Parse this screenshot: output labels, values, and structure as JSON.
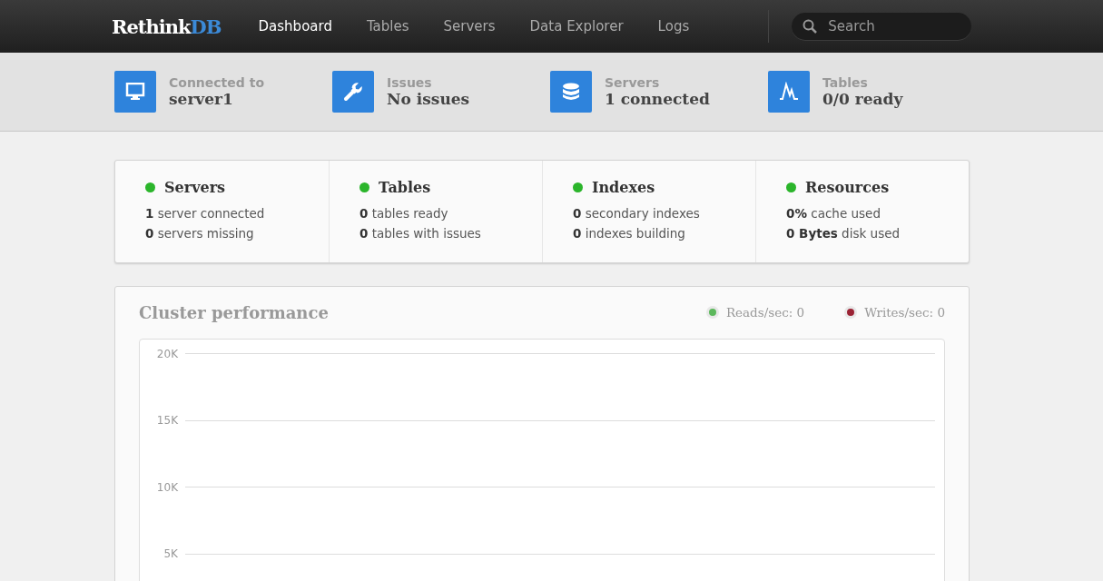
{
  "navbar": {
    "logo": {
      "part_1": "Rethink",
      "part_2": "DB"
    },
    "items": [
      {
        "label": "Dashboard",
        "selected": true
      },
      {
        "label": "Tables",
        "selected": false
      },
      {
        "label": "Servers",
        "selected": false
      },
      {
        "label": "Data Explorer",
        "selected": false
      },
      {
        "label": "Logs",
        "selected": false
      }
    ],
    "search": {
      "placeholder": "Search"
    }
  },
  "summary": [
    {
      "kind": "monitor",
      "label": "Connected to",
      "value": "server1"
    },
    {
      "kind": "wrench",
      "label": "Issues",
      "value": "No issues"
    },
    {
      "kind": "database",
      "label": "Servers",
      "value": "1 connected"
    },
    {
      "kind": "pulse",
      "label": "Tables",
      "value": "0/0 ready"
    }
  ],
  "status_cards": [
    {
      "title": "Servers",
      "color": "#2bb52b",
      "lines": [
        "**1** server connected",
        "**0** servers missing"
      ]
    },
    {
      "title": "Tables",
      "color": "#2bb52b",
      "lines": [
        "**0** tables ready",
        "**0** tables with issues"
      ]
    },
    {
      "title": "Indexes",
      "color": "#2bb52b",
      "lines": [
        "**0** secondary indexes",
        "**0** indexes building"
      ]
    },
    {
      "title": "Resources",
      "color": "#2bb52b",
      "lines": [
        "**0%** cache used",
        "**0 Bytes** disk used"
      ]
    }
  ],
  "performance": {
    "title": "Cluster performance",
    "legend": [
      {
        "label": "Reads/sec: 0",
        "color": "#5cb85c"
      },
      {
        "label": "Writes/sec: 0",
        "color": "#9b2335"
      }
    ],
    "axis_labels": [
      "20K",
      "15K",
      "10K",
      "5K"
    ]
  }
}
